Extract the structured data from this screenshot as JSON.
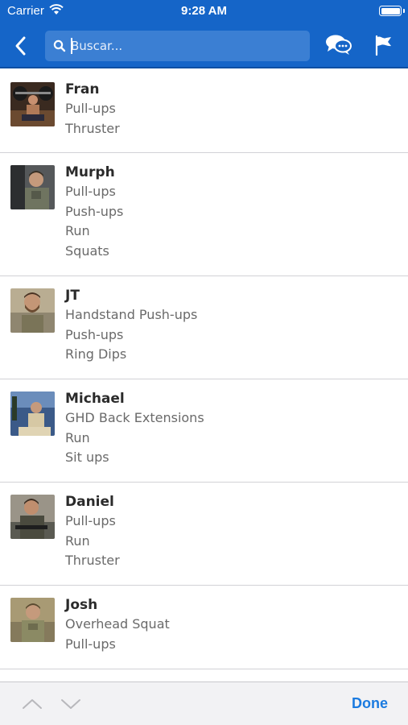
{
  "status_bar": {
    "carrier": "Carrier",
    "time": "9:28 AM"
  },
  "nav": {
    "search_placeholder": "Buscar...",
    "back_icon": "chevron-left-icon",
    "chat_icon": "chat-bubbles-icon",
    "flag_icon": "flag-icon"
  },
  "workouts": [
    {
      "name": "Fran",
      "movements": [
        "Pull-ups",
        "Thruster"
      ]
    },
    {
      "name": "Murph",
      "movements": [
        "Pull-ups",
        "Push-ups",
        "Run",
        "Squats"
      ]
    },
    {
      "name": "JT",
      "movements": [
        "Handstand Push-ups",
        "Push-ups",
        "Ring Dips"
      ]
    },
    {
      "name": "Michael",
      "movements": [
        "GHD Back Extensions",
        "Run",
        "Sit ups"
      ]
    },
    {
      "name": "Daniel",
      "movements": [
        "Pull-ups",
        "Run",
        "Thruster"
      ]
    },
    {
      "name": "Josh",
      "movements": [
        "Overhead Squat",
        "Pull-ups"
      ]
    }
  ],
  "toolbar": {
    "done_label": "Done"
  },
  "colors": {
    "nav_background": "#1565c8",
    "search_field": "#3b7fd3",
    "accent": "#1b7be0",
    "title_text": "#2b2b2b",
    "secondary_text": "#6a6a6a"
  }
}
